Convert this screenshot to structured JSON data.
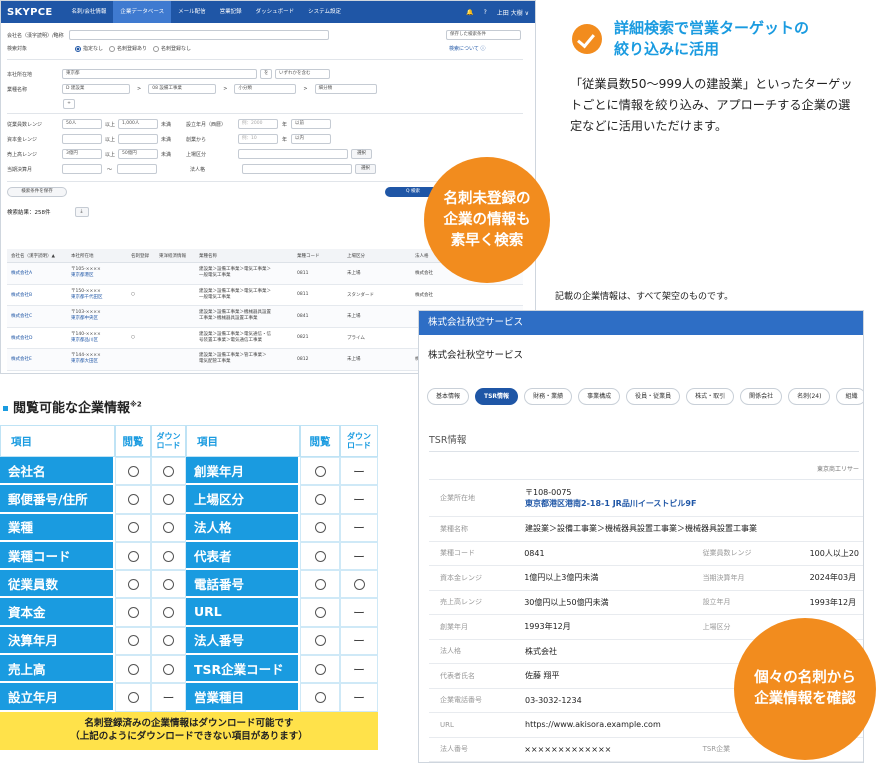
{
  "app": {
    "logo": "SKYPCE",
    "nav": [
      "名刺/会社情報",
      "企業データベース",
      "メール配信",
      "営業記録",
      "ダッシュボード",
      "システム設定"
    ],
    "nav_active_index": 1,
    "user": "上田 大樹 ∨",
    "search_form": {
      "company_name_label": "会社名（漢字読明）/略称",
      "saved_cond": "保存した検索条件",
      "target_label": "検索対象",
      "target_options": [
        "指定なし",
        "名刺登録あり",
        "名刺登録なし"
      ],
      "search_help": "検索について ⓘ",
      "location_label": "本社所在地",
      "location_value": "東京都",
      "location_mode": "いずれかを含む",
      "industry_label": "業種名称",
      "industry_1": "D 建設業",
      "industry_2": "08 設備工事業",
      "industry_3": "小分類",
      "industry_4": "細分類",
      "plus": "+",
      "employees_label": "従業員数レンジ",
      "employees_from": "50人",
      "employees_op": "以上",
      "employees_to": "1,000人",
      "employees_unit": "未満",
      "founded_label": "設立年月（西暦）",
      "founded_placeholder": "例：2000",
      "founded_year": "年",
      "founded_after": "以前",
      "capital_label": "資本金レンジ",
      "capital_op": "以上",
      "capital_unit": "未満",
      "since_label": "創業から",
      "since_placeholder": "例：10",
      "since_year": "年",
      "since_within": "以内",
      "sales_label": "売上高レンジ",
      "sales_from": "3億円",
      "sales_op": "以上",
      "sales_to": "50億円",
      "sales_unit": "未満",
      "listing_label": "上場区分",
      "select_btn": "選択",
      "fiscal_label": "当期決算月",
      "fiscal_tilde": "〜",
      "corp_label": "法人格",
      "save_btn": "検索条件を保存",
      "search_btn": "Q 検索",
      "result_count": "検索結果：258件"
    },
    "results": {
      "headers": [
        "会社名（漢字読明）▲",
        "本社所在地",
        "名刺登録",
        "東洋経済情報",
        "業種名称",
        "業種コード",
        "上場区分",
        "法人格"
      ],
      "rows": [
        {
          "name": "株式会社A",
          "zip": "〒105-××××",
          "addr": "東京都港区",
          "card": "",
          "toyo": "",
          "ind1": "建設業＞設備工事業＞電気工事業＞",
          "ind2": "一般電気工事業",
          "code": "0811",
          "listing": "未上場",
          "corp": "株式会社"
        },
        {
          "name": "株式会社B",
          "zip": "〒150-××××",
          "addr": "東京都千代田区",
          "card": "○",
          "toyo": "",
          "ind1": "建設業＞設備工事業＞電気工事業＞",
          "ind2": "一般電気工事業",
          "code": "0811",
          "listing": "スタンダード",
          "corp": "株式会社"
        },
        {
          "name": "株式会社C",
          "zip": "〒103-××××",
          "addr": "東京都中央区",
          "card": "",
          "toyo": "",
          "ind1": "建設業＞設備工事業＞機械器具設置",
          "ind2": "工事業＞機械器具設置工事業",
          "code": "0841",
          "listing": "未上場",
          "corp": ""
        },
        {
          "name": "株式会社D",
          "zip": "〒140-××××",
          "addr": "東京都品川区",
          "card": "○",
          "toyo": "",
          "ind1": "建設業＞設備工事業＞電気通信・信",
          "ind2": "号装置工事業＞電気通信工事業",
          "code": "0821",
          "listing": "プライム",
          "corp": ""
        },
        {
          "name": "株式会社E",
          "zip": "〒144-××××",
          "addr": "東京都大田区",
          "card": "",
          "toyo": "",
          "ind1": "建設業＞設備工事業＞管工事業＞",
          "ind2": "電気配管工事業",
          "code": "0812",
          "listing": "未上場",
          "corp": "株式会社"
        }
      ]
    }
  },
  "callout": {
    "headline_1": "詳細検索で営業ターゲットの",
    "headline_2": "絞り込みに活用",
    "desc": "「従業員数50〜999人の建設業」といったターゲットごとに情報を絞り込み、アプローチする企業の選定などに活用いただけます。"
  },
  "bubble_search": {
    "l1": "名刺未登録の",
    "l2": "企業の情報も",
    "l3": "素早く検索"
  },
  "bubble_detail": {
    "l1": "個々の名刺から",
    "l2": "企業情報を確認"
  },
  "note": "記載の企業情報は、すべて架空のものです。",
  "detail": {
    "header": "株式会社秋空サービス",
    "name": "株式会社秋空サービス",
    "tabs": [
      "基本情報",
      "TSR情報",
      "財務・業績",
      "事業構成",
      "役員・従業員",
      "株式・取引",
      "関係会社",
      "名刺(24)",
      "組織"
    ],
    "active_tab": 1,
    "section": "TSR情報",
    "source": "東京商工リサー",
    "rows": [
      {
        "k": "企業所在地",
        "zip": "〒108-0075",
        "v": "東京都港区港南2-18-1 JR品川イーストビル9F",
        "k2": "",
        "v2": ""
      },
      {
        "k": "業種名称",
        "v": "建設業＞設備工事業＞機械器具設置工事業＞機械器具設置工事業",
        "k2": "",
        "v2": ""
      },
      {
        "k": "業種コード",
        "v": "0841",
        "k2": "従業員数レンジ",
        "v2": "100人以上20"
      },
      {
        "k": "資本金レンジ",
        "v": "1億円以上3億円未満",
        "k2": "当期決算年月",
        "v2": "2024年03月"
      },
      {
        "k": "売上高レンジ",
        "v": "30億円以上50億円未満",
        "k2": "設立年月",
        "v2": "1993年12月"
      },
      {
        "k": "創業年月",
        "v": "1993年12月",
        "k2": "上場区分",
        "v2": ""
      },
      {
        "k": "法人格",
        "v": "株式会社",
        "k2": "",
        "v2": ""
      },
      {
        "k": "代表者氏名",
        "v": "佐藤 翔平",
        "k2": "",
        "v2": ""
      },
      {
        "k": "企業電話番号",
        "v": "03-3032-1234",
        "k2": "",
        "v2": ""
      },
      {
        "k": "URL",
        "v": "https://www.akisora.example.com",
        "k2": "",
        "v2": ""
      },
      {
        "k": "法人番号",
        "v": "×××××××××××××",
        "k2": "TSR企業",
        "v2": "×"
      }
    ]
  },
  "view_table": {
    "title": "閲覧可能な企業情報",
    "title_sup": "※2",
    "headers": [
      "項目",
      "閲覧",
      "ダウンロード",
      "項目",
      "閲覧",
      "ダウンロード"
    ],
    "download_header_l1": "ダウン",
    "download_header_l2": "ロード",
    "rows": [
      [
        "会社名",
        "○",
        "○",
        "創業年月",
        "○",
        "ー"
      ],
      [
        "郵便番号/住所",
        "○",
        "○",
        "上場区分",
        "○",
        "ー"
      ],
      [
        "業種",
        "○",
        "○",
        "法人格",
        "○",
        "ー"
      ],
      [
        "業種コード",
        "○",
        "○",
        "代表者",
        "○",
        "ー"
      ],
      [
        "従業員数",
        "○",
        "○",
        "電話番号",
        "○",
        "○"
      ],
      [
        "資本金",
        "○",
        "○",
        "URL",
        "○",
        "ー"
      ],
      [
        "決算年月",
        "○",
        "○",
        "法人番号",
        "○",
        "ー"
      ],
      [
        "売上高",
        "○",
        "○",
        "TSR企業コード",
        "○",
        "ー"
      ],
      [
        "設立年月",
        "○",
        "ー",
        "営業種目",
        "○",
        "ー"
      ]
    ],
    "footer_1": "名刺登録済みの企業情報はダウンロード可能です",
    "footer_2": "（上記のようにダウンロードできない項目があります）"
  },
  "colors": {
    "brand": "#1f56a6",
    "accent": "#f28c1e",
    "cyan": "#1a9be0",
    "yellow": "#ffe24a"
  }
}
